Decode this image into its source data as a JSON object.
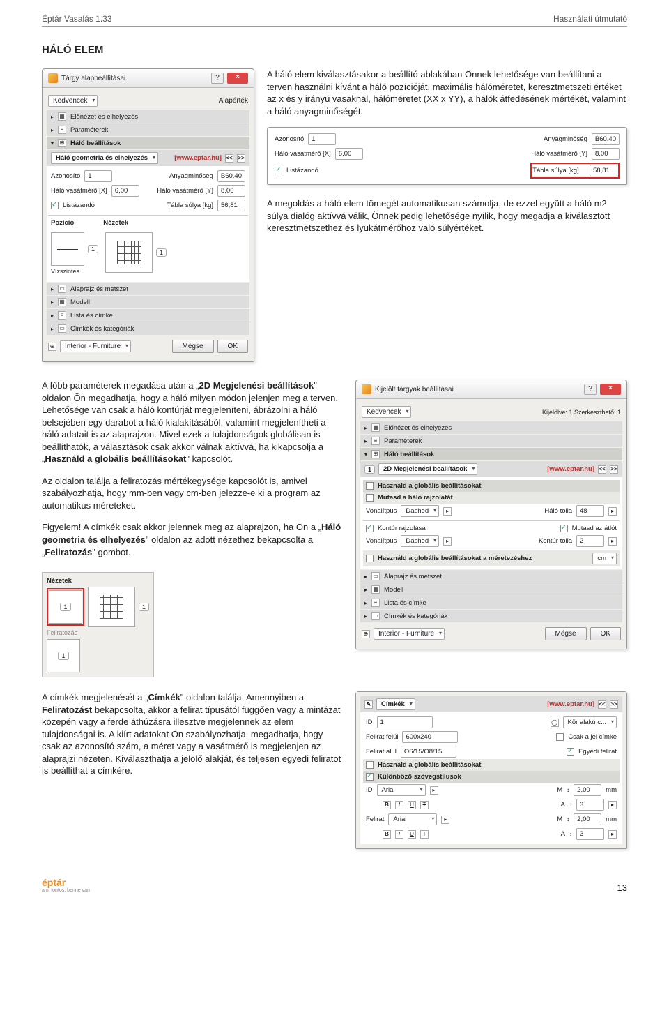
{
  "header": {
    "left": "Éptár Vasalás 1.33",
    "right": "Használati útmutató"
  },
  "section_title": "HÁLÓ ELEM",
  "para1": "A háló elem kiválasztásakor a beállító ablakában Önnek lehetősége van beállítani a terven használni kívánt a háló pozícióját, maximális hálóméretet, keresztmetszeti értéket az x és y irányú vasaknál, hálóméretet (XX x YY), a hálók átfedésének mértékét, valamint a háló anyagminőségét.",
  "para2": "A megoldás a háló elem tömegét automatikusan számolja, de ezzel együtt a háló m2 súlya dialóg aktívvá válik, Önnek pedig lehetősége nyílik, hogy megadja a kiválasztott keresztmetszethez és lyukátmérőhöz való súlyértéket.",
  "para3_html": "A főbb paraméterek megadása után a „<b>2D Megjelenési beállítások</b>\" oldalon Ön megadhatja, hogy a háló milyen módon jelenjen meg a terven. Lehetősége van csak a háló kontúrját megjeleníteni, ábrázolni a háló belsejében egy darabot a háló kialakításából, valamint megjelenítheti a háló adatait is az alaprajzon. Mivel ezek a tulajdonságok globálisan is beállíthatók, a választások csak akkor válnak aktívvá, ha kikapcsolja a „<b>Használd a globális beállításokat</b>\" kapcsolót.",
  "para4": "Az oldalon találja a feliratozás mértékegysége kapcsolót is, amivel szabályozhatja, hogy mm-ben vagy cm-ben jelezze-e ki a program az automatikus méreteket.",
  "para5_html": "Figyelem! A címkék csak akkor jelennek meg az alaprajzon, ha Ön a „<b>Háló geometria és elhelyezés</b>\" oldalon az adott nézethez bekapcsolta a „<b>Feliratozás</b>\" gombot.",
  "para6_html": "A címkék megjelenését a „<b>Címkék</b>\" oldalon találja. Amennyiben a <b>Feliratozást</b> bekapcsolta, akkor a felirat típusától függően vagy a mintázat közepén vagy a ferde áthúzásra illesztve megjelennek az elem tulajdonságai is. A kiírt adatokat Ön szabályozhatja, megadhatja, hogy csak az azonosító szám, a méret vagy a vasátmérő is megjelenjen az alaprajzi nézeten. Kiválaszthatja a jelölő alakját, és teljesen egyedi feliratot is beállíthat a címkére.",
  "dlg1": {
    "title": "Tárgy alapbeállításai",
    "fav": "Kedvencek",
    "default": "Alapérték",
    "rows": [
      "Előnézet és elhelyezés",
      "Paraméterek",
      "Háló beállítások"
    ],
    "panel": "Háló geometria és elhelyezés",
    "brand": "[www.eptar.hu]",
    "r1": {
      "azon": "Azonosító",
      "azon_v": "1",
      "anyag": "Anyagminőség",
      "anyag_v": "B60.40"
    },
    "r2": {
      "x": "Háló vasátmérő [X]",
      "x_v": "6,00",
      "y": "Háló vasátmérő [Y]",
      "y_v": "8,00"
    },
    "r3": {
      "list": "Listázandó",
      "suly": "Tábla súlya [kg]",
      "suly_v": "56,81"
    },
    "poz": "Pozíció",
    "nez": "Nézetek",
    "visz": "Vízszintes",
    "foot_rows": [
      "Alaprajz és metszet",
      "Modell",
      "Lista és címke",
      "Címkék és kategóriák"
    ],
    "cat": "Interior - Furniture",
    "cancel": "Mégse",
    "ok": "OK"
  },
  "dlg_inset": {
    "r1": {
      "azon": "Azonosító",
      "azon_v": "1",
      "anyag": "Anyagminőség",
      "anyag_v": "B60.40"
    },
    "r2": {
      "x": "Háló vasátmérő [X]",
      "x_v": "6,00",
      "y": "Háló vasátmérő [Y]",
      "y_v": "8,00"
    },
    "r3": {
      "list": "Listázandó",
      "suly": "Tábla súlya [kg]",
      "suly_v": "58,81"
    }
  },
  "dlg2": {
    "title": "Kijelölt tárgyak beállításai",
    "subtitle": "Kijelölve: 1 Szerkeszthető: 1",
    "fav": "Kedvencek",
    "rows": [
      "Előnézet és elhelyezés",
      "Paraméterek",
      "Háló beállítások"
    ],
    "panel": "2D Megjelenési beállítások",
    "brand": "[www.eptar.hu]",
    "global": "Használd a globális beállításokat",
    "mutasd": "Mutasd a háló rajzolatát",
    "vonal": "Vonalítpus",
    "dashed": "Dashed",
    "tolla": "Háló tolla",
    "tolla_v": "48",
    "kontur": "Kontúr rajzolása",
    "atlot": "Mutasd az átlót",
    "vonal2": "Vonalítpus",
    "ktolla": "Kontúr tolla",
    "ktolla_v": "2",
    "global2": "Használd a globális beállításokat a méretezéshez",
    "cm": "cm",
    "foot_rows": [
      "Alaprajz és metszet",
      "Modell",
      "Lista és címke",
      "Címkék és kategóriák"
    ],
    "cat": "Interior - Furniture",
    "cancel": "Mégse",
    "ok": "OK"
  },
  "smalldlg": {
    "nez": "Nézetek",
    "felir": "Feliratozás"
  },
  "dlg3": {
    "panel": "Címkék",
    "brand": "[www.eptar.hu]",
    "id": "ID",
    "id_v": "1",
    "kor": "Kör alakú c...",
    "ff": "Felirat felül",
    "ff_v": "600x240",
    "csak": "Csak a jel címke",
    "fa": "Felirat alul",
    "fa_v": "O6/15/O8/15",
    "egyedi": "Egyedi felirat",
    "global": "Használd a globális beállításokat",
    "kulon": "Különböző szövegstílusok",
    "idlab": "ID",
    "arial": "Arial",
    "m1": "2,00",
    "mm": "mm",
    "a1": "3",
    "felirat": "Felirat",
    "m2": "2,00",
    "a2": "3"
  },
  "page_number": "13",
  "logo": {
    "main": "éptár",
    "sub": "ami fontos, benne van"
  }
}
